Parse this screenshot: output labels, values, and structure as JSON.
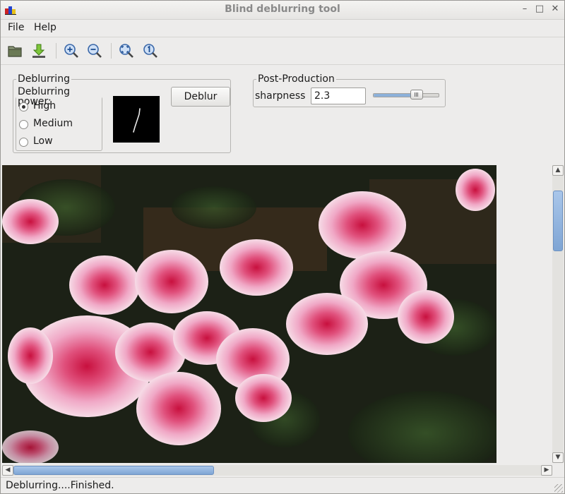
{
  "window": {
    "title": "Blind deblurring tool",
    "controls": [
      "minimize-icon",
      "maximize-icon",
      "close-icon"
    ],
    "min_glyph": "–",
    "max_glyph": "□",
    "close_glyph": "✕"
  },
  "menubar": {
    "file": "File",
    "help": "Help"
  },
  "toolbar": {
    "icons": [
      "open-folder-icon",
      "save-download-icon",
      "zoom-in-icon",
      "zoom-out-icon",
      "zoom-fit-icon",
      "zoom-original-icon"
    ]
  },
  "deblurring": {
    "group_title": "Deblurring",
    "power_title": "Deblurring power:",
    "options": [
      {
        "label": "High",
        "checked": true
      },
      {
        "label": "Medium",
        "checked": false
      },
      {
        "label": "Low",
        "checked": false
      }
    ],
    "button": "Deblur"
  },
  "post_production": {
    "group_title": "Post-Production",
    "sharpness_label": "sharpness",
    "sharpness_value": "2.3",
    "slider_fraction": 0.7
  },
  "scroll": {
    "vertical_position": 0.05,
    "vertical_visible": 0.22,
    "horizontal_position": 0.0,
    "horizontal_visible": 0.38,
    "up_glyph": "▲",
    "down_glyph": "▼",
    "left_glyph": "◀",
    "right_glyph": "▶"
  },
  "status": {
    "text": "Deblurring....Finished."
  },
  "colors": {
    "background": "#edeceb",
    "scroll_thumb": "#8cb0da",
    "flower_pink": "#e8a0c0",
    "flower_core": "#d2245a",
    "foliage": "#1e2a14"
  }
}
